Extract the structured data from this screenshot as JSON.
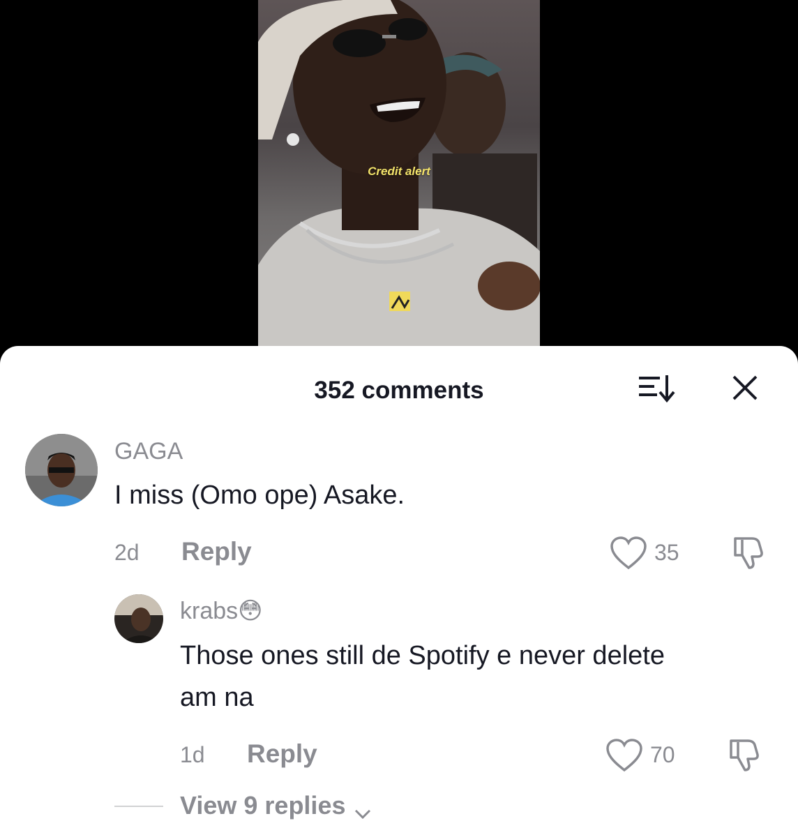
{
  "video": {
    "caption": "Credit alert"
  },
  "comments_panel": {
    "title": "352 comments",
    "sort_icon": "sort-icon",
    "close_icon": "close-icon"
  },
  "comments": [
    {
      "username": "GAGA",
      "text": "I miss (Omo ope) Asake.",
      "time": "2d",
      "reply_label": "Reply",
      "likes": "35"
    }
  ],
  "replies": [
    {
      "username": "krabs",
      "emoji": "😳",
      "text_line1": "Those ones still de Spotify e never delete",
      "text_line2": "am na",
      "time": "1d",
      "reply_label": "Reply",
      "likes": "70"
    }
  ],
  "view_replies": {
    "label": "View 9 replies"
  },
  "colors": {
    "caption": "#f3e36a",
    "title": "#161823",
    "muted": "#8a8b91"
  }
}
